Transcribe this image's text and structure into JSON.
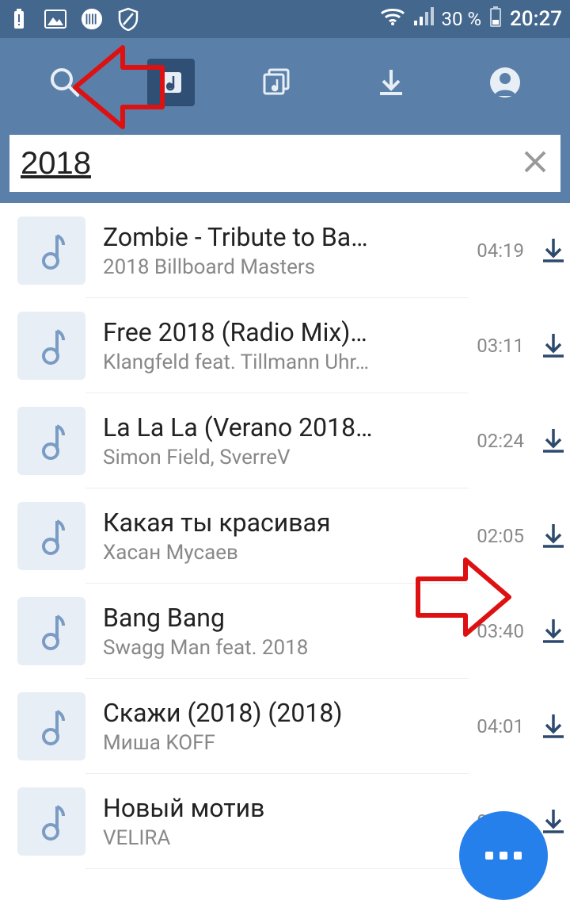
{
  "status": {
    "battery_percent": "30 %",
    "time": "20:27"
  },
  "search": {
    "value": "2018"
  },
  "tracks": [
    {
      "title": "Zombie - Tribute to Ba…",
      "artist": "2018 Billboard Masters",
      "duration": "04:19"
    },
    {
      "title": "Free 2018 (Radio Mix)…",
      "artist": "Klangfeld feat. Tillmann Uhr…",
      "duration": "03:11"
    },
    {
      "title": "La La La (Verano 2018…",
      "artist": "Simon Field, SverreV",
      "duration": "02:24"
    },
    {
      "title": "Какая ты красивая",
      "artist": "Хасан Мусаев",
      "duration": "02:05"
    },
    {
      "title": "Bang Bang",
      "artist": "Swagg Man feat. 2018",
      "duration": "03:40"
    },
    {
      "title": "Скажи (2018) (2018)",
      "artist": "Миша KOFF",
      "duration": "04:01"
    },
    {
      "title": "Новый мотив",
      "artist": "VELIRA",
      "duration": "03:30"
    }
  ]
}
